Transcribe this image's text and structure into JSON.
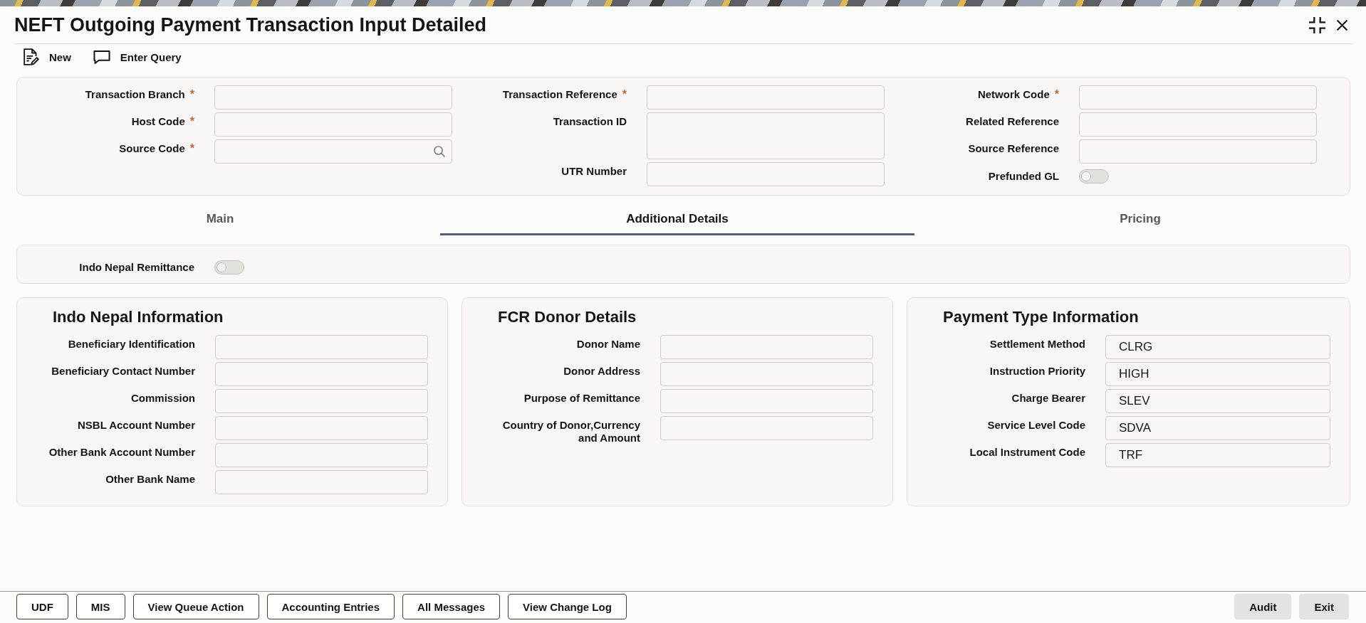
{
  "window": {
    "title": "NEFT Outgoing Payment Transaction Input Detailed"
  },
  "toolbar": [
    {
      "kind": "new",
      "label": "New"
    },
    {
      "kind": "query",
      "label": "Enter Query"
    }
  ],
  "header_form": {
    "columns": [
      [
        {
          "kind": "text",
          "label": "Transaction Branch",
          "required_mark": "*"
        },
        {
          "kind": "text",
          "label": "Host Code",
          "required_mark": "*"
        },
        {
          "kind": "lookup",
          "label": "Source Code",
          "required_mark": "*"
        }
      ],
      [
        {
          "kind": "text",
          "label": "Transaction Reference",
          "required_mark": "*"
        },
        {
          "kind": "textarea",
          "label": "Transaction ID"
        },
        {
          "kind": "text",
          "label": "UTR Number"
        }
      ],
      [
        {
          "kind": "text",
          "label": "Network Code",
          "required_mark": "*"
        },
        {
          "kind": "text",
          "label": "Related Reference"
        },
        {
          "kind": "text",
          "label": "Source Reference"
        },
        {
          "kind": "toggle",
          "label": "Prefunded GL",
          "on": false
        }
      ]
    ]
  },
  "tabs": [
    {
      "label": "Main",
      "selected": false
    },
    {
      "label": "Additional Details",
      "selected": true
    },
    {
      "label": "Pricing",
      "selected": false
    }
  ],
  "remittance": {
    "label": "Indo Nepal Remittance",
    "on": false
  },
  "sections": [
    {
      "title": "Indo Nepal Information",
      "fields": [
        {
          "label": "Beneficiary Identification"
        },
        {
          "label": "Beneficiary Contact Number"
        },
        {
          "label": "Commission"
        },
        {
          "label": "NSBL Account Number"
        },
        {
          "label": "Other Bank Account Number"
        },
        {
          "label": "Other Bank Name"
        }
      ]
    },
    {
      "title": "FCR Donor Details",
      "fields": [
        {
          "label": "Donor Name"
        },
        {
          "label": "Donor Address"
        },
        {
          "label": "Purpose of Remittance"
        },
        {
          "label": "Country of Donor,Currency and Amount"
        }
      ]
    },
    {
      "title": "Payment Type Information",
      "fields": [
        {
          "label": "Settlement Method",
          "value": "CLRG"
        },
        {
          "label": "Instruction Priority",
          "value": "HIGH"
        },
        {
          "label": "Charge Bearer",
          "value": "SLEV"
        },
        {
          "label": "Service Level Code",
          "value": "SDVA"
        },
        {
          "label": "Local Instrument Code",
          "value": "TRF"
        }
      ]
    }
  ],
  "footer": {
    "left_buttons": [
      "UDF",
      "MIS",
      "View Queue Action",
      "Accounting Entries",
      "All Messages",
      "View Change Log"
    ],
    "right_buttons": [
      "Audit",
      "Exit"
    ]
  }
}
